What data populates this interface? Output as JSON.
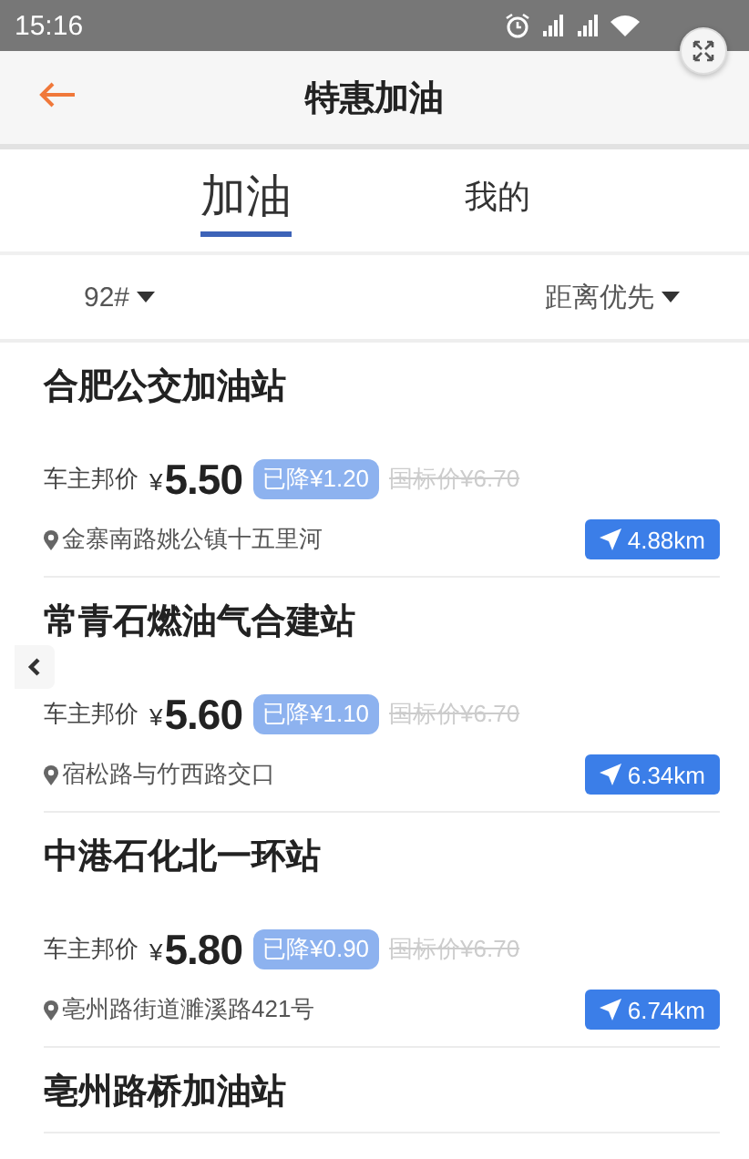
{
  "status_bar": {
    "time": "15:16"
  },
  "header": {
    "title": "特惠加油"
  },
  "tabs": [
    {
      "label": "加油",
      "selected": true
    },
    {
      "label": "我的",
      "selected": false
    }
  ],
  "filters": [
    {
      "label": "92#"
    },
    {
      "label": "距离优先"
    }
  ],
  "stations": [
    {
      "name": "合肥公交加油站",
      "price_label": "车主邦价",
      "currency": "¥",
      "price": "5.50",
      "discount": "已降¥1.20",
      "list_price": "国标价¥6.70",
      "address": "金寨南路姚公镇十五里河",
      "distance": "4.88km"
    },
    {
      "name": "常青石燃油气合建站",
      "price_label": "车主邦价",
      "currency": "¥",
      "price": "5.60",
      "discount": "已降¥1.10",
      "list_price": "国标价¥6.70",
      "address": "宿松路与竹西路交口",
      "distance": "6.34km"
    },
    {
      "name": "中港石化北一环站",
      "price_label": "车主邦价",
      "currency": "¥",
      "price": "5.80",
      "discount": "已降¥0.90",
      "list_price": "国标价¥6.70",
      "address": "亳州路街道濉溪路421号",
      "distance": "6.74km"
    },
    {
      "name": "亳州路桥加油站"
    }
  ]
}
